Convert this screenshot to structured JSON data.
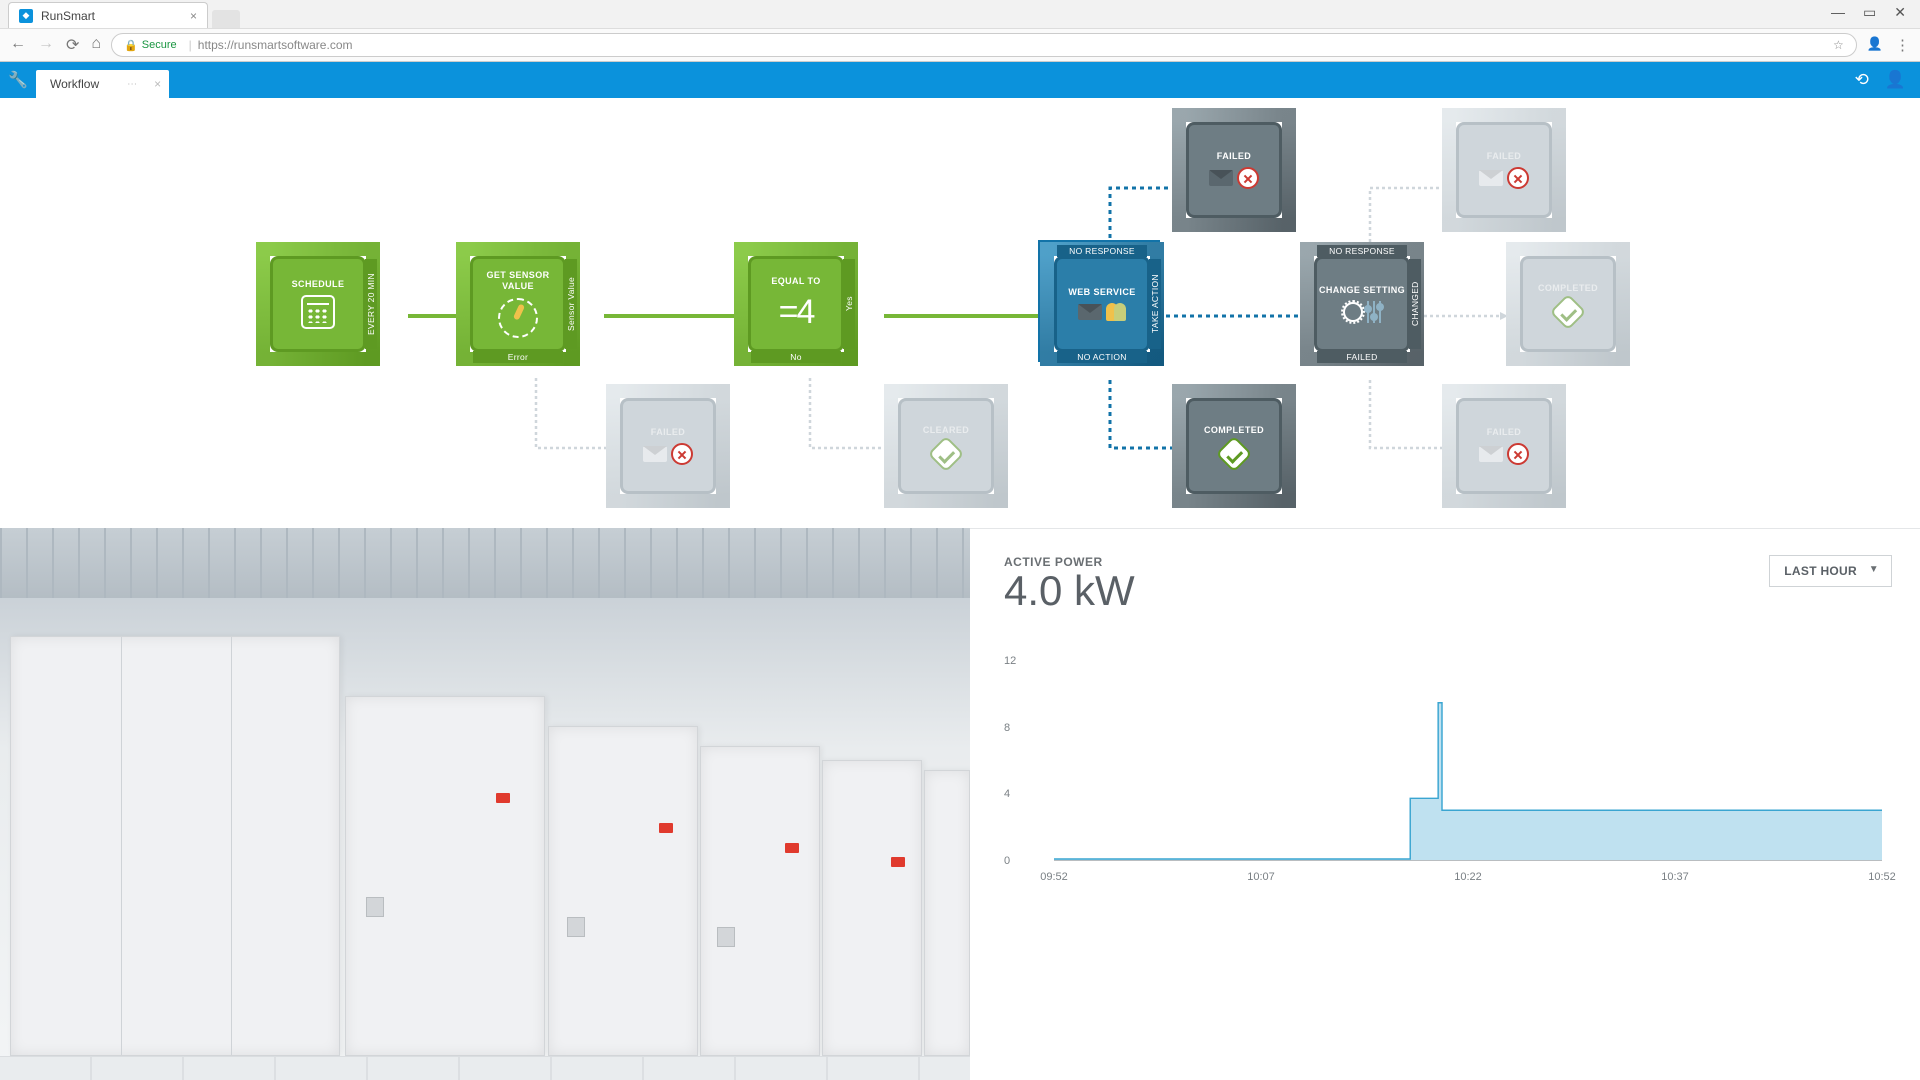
{
  "browser": {
    "tab_title": "RunSmart",
    "secure_label": "Secure",
    "url_display": "https://runsmartsoftware.com"
  },
  "app": {
    "active_tab": "Workflow"
  },
  "workflow": {
    "nodes": {
      "schedule": {
        "title": "SCHEDULE",
        "port_right": "EVERY 20 MIN"
      },
      "get_sensor": {
        "title": "GET SENSOR VALUE",
        "port_right": "Sensor Value",
        "port_bottom": "Error"
      },
      "equal_to": {
        "title": "EQUAL TO",
        "big": "=4",
        "port_right": "Yes",
        "port_bottom": "No"
      },
      "web_service": {
        "title": "WEB SERVICE",
        "port_top": "NO RESPONSE",
        "port_right": "TAKE ACTION",
        "port_bottom": "NO ACTION"
      },
      "change_setting": {
        "title": "CHANGE SETTING",
        "port_top": "NO RESPONSE",
        "port_right": "CHANGED",
        "port_bottom": "FAILED"
      },
      "failed_top_a": {
        "title": "FAILED"
      },
      "failed_top_b": {
        "title": "FAILED"
      },
      "completed_r": {
        "title": "COMPLETED"
      },
      "failed_bl": {
        "title": "FAILED"
      },
      "cleared": {
        "title": "CLEARED"
      },
      "completed_b": {
        "title": "COMPLETED"
      },
      "failed_br": {
        "title": "FAILED"
      }
    }
  },
  "panel": {
    "title": "ACTIVE POWER",
    "value": "4.0 kW",
    "range_selected": "LAST HOUR"
  },
  "chart_data": {
    "type": "area",
    "title": "ACTIVE POWER",
    "ylabel": "kW",
    "ylim": [
      0,
      12
    ],
    "y_ticks": [
      0.0,
      4.0,
      8.0,
      12.0
    ],
    "x_ticks": [
      "09:52",
      "10:07",
      "10:22",
      "10:37",
      "10:52"
    ],
    "series": [
      {
        "name": "Active Power (kW)",
        "color": "#9ad2ea",
        "points": [
          {
            "t": "09:52",
            "v": 0.0
          },
          {
            "t": "10:05",
            "v": 0.0
          },
          {
            "t": "10:18",
            "v": 0.0
          },
          {
            "t": "10:18",
            "v": 3.7
          },
          {
            "t": "10:21",
            "v": 3.7
          },
          {
            "t": "10:21",
            "v": 9.5
          },
          {
            "t": "10:21",
            "v": 3.0
          },
          {
            "t": "10:30",
            "v": 3.0
          },
          {
            "t": "10:40",
            "v": 3.0
          },
          {
            "t": "10:52",
            "v": 3.0
          }
        ]
      }
    ]
  }
}
